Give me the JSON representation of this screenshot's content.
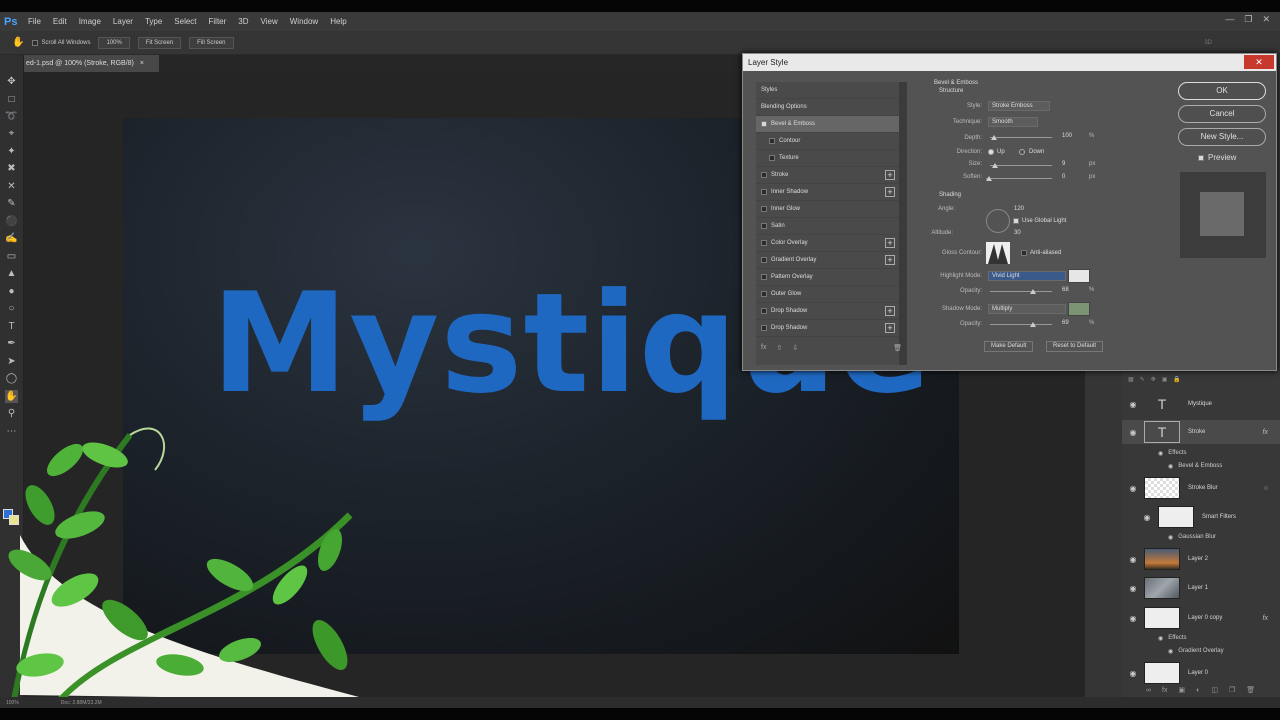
{
  "app": {
    "logo": "Ps"
  },
  "menu": [
    "File",
    "Edit",
    "Image",
    "Layer",
    "Type",
    "Select",
    "Filter",
    "3D",
    "View",
    "Window",
    "Help"
  ],
  "options": {
    "scroll_all": "Scroll All Windows",
    "zoom": "100%",
    "fit_screen": "Fit Screen",
    "fill_screen": "Fill Screen",
    "mode_3d": "3D"
  },
  "document": {
    "tab_title": "ed-1.psd @ 100% (Stroke, RGB/8)",
    "canvas_text": "Mystique"
  },
  "status": {
    "zoom": "100%",
    "doc": "Doc: 2.88M/23.2M"
  },
  "colors": {
    "foreground": "#2c6fd6",
    "background": "#e9e38f",
    "text": "#1f68c2"
  },
  "dialog": {
    "title": "Layer Style",
    "styles": [
      {
        "label": "Styles",
        "checkbox": false,
        "plus": false,
        "checked": false
      },
      {
        "label": "Blending Options",
        "checkbox": false,
        "plus": false,
        "checked": false
      },
      {
        "label": "Bevel & Emboss",
        "checkbox": true,
        "plus": false,
        "checked": true
      },
      {
        "label": "Contour",
        "checkbox": true,
        "plus": false,
        "checked": false,
        "indent": true
      },
      {
        "label": "Texture",
        "checkbox": true,
        "plus": false,
        "checked": false,
        "indent": true
      },
      {
        "label": "Stroke",
        "checkbox": true,
        "plus": true,
        "checked": false
      },
      {
        "label": "Inner Shadow",
        "checkbox": true,
        "plus": true,
        "checked": false
      },
      {
        "label": "Inner Glow",
        "checkbox": true,
        "plus": false,
        "checked": false
      },
      {
        "label": "Satin",
        "checkbox": true,
        "plus": false,
        "checked": false
      },
      {
        "label": "Color Overlay",
        "checkbox": true,
        "plus": true,
        "checked": false
      },
      {
        "label": "Gradient Overlay",
        "checkbox": true,
        "plus": true,
        "checked": false
      },
      {
        "label": "Pattern Overlay",
        "checkbox": true,
        "plus": false,
        "checked": false
      },
      {
        "label": "Outer Glow",
        "checkbox": true,
        "plus": false,
        "checked": false
      },
      {
        "label": "Drop Shadow",
        "checkbox": true,
        "plus": true,
        "checked": false
      },
      {
        "label": "Drop Shadow",
        "checkbox": true,
        "plus": true,
        "checked": false
      }
    ],
    "bevel": {
      "section": "Bevel & Emboss",
      "structure": "Structure",
      "style_label": "Style:",
      "style_value": "Stroke Emboss",
      "technique_label": "Technique:",
      "technique_value": "Smooth",
      "depth_label": "Depth:",
      "depth_value": "100",
      "depth_unit": "%",
      "direction_label": "Direction:",
      "dir_up": "Up",
      "dir_down": "Down",
      "size_label": "Size:",
      "size_value": "9",
      "size_unit": "px",
      "soften_label": "Soften:",
      "soften_value": "0",
      "soften_unit": "px",
      "shading": "Shading",
      "angle_label": "Angle:",
      "angle_value": "120",
      "global_light": "Use Global Light",
      "altitude_label": "Altitude:",
      "altitude_value": "30",
      "gloss_label": "Gloss Contour:",
      "antialiased": "Anti-aliased",
      "highlight_label": "Highlight Mode:",
      "highlight_value": "Vivid Light",
      "hl_opacity_label": "Opacity:",
      "hl_opacity_value": "68",
      "hl_opacity_unit": "%",
      "shadow_label": "Shadow Mode:",
      "shadow_value": "Multiply",
      "sh_opacity_label": "Opacity:",
      "sh_opacity_value": "69",
      "sh_opacity_unit": "%",
      "make_default": "Make Default",
      "reset_default": "Reset to Default",
      "highlight_color": "#e6e6e6",
      "shadow_color": "#7d9474"
    },
    "ok": "OK",
    "cancel": "Cancel",
    "new_style": "New Style...",
    "preview": "Preview"
  },
  "layers": {
    "rows": [
      {
        "name": "Mystique",
        "thumb": "text"
      },
      {
        "name": "Stroke",
        "thumb": "text",
        "fx": true,
        "selected": true
      },
      {
        "name": "Stroke Blur",
        "thumb": "checker"
      },
      {
        "name": "Smart Filters",
        "thumb": "white"
      },
      {
        "name": "Layer 2",
        "thumb": "sunset"
      },
      {
        "name": "Layer 1",
        "thumb": "cloud"
      },
      {
        "name": "Layer 0 copy",
        "thumb": "white",
        "fx": true
      },
      {
        "name": "Layer 0",
        "thumb": "white"
      }
    ],
    "effects_label": "Effects",
    "stroke_effect": "Bevel & Emboss",
    "gaussian": "Gaussian Blur",
    "copy_effect": "Gradient Overlay",
    "fx": "fx"
  }
}
